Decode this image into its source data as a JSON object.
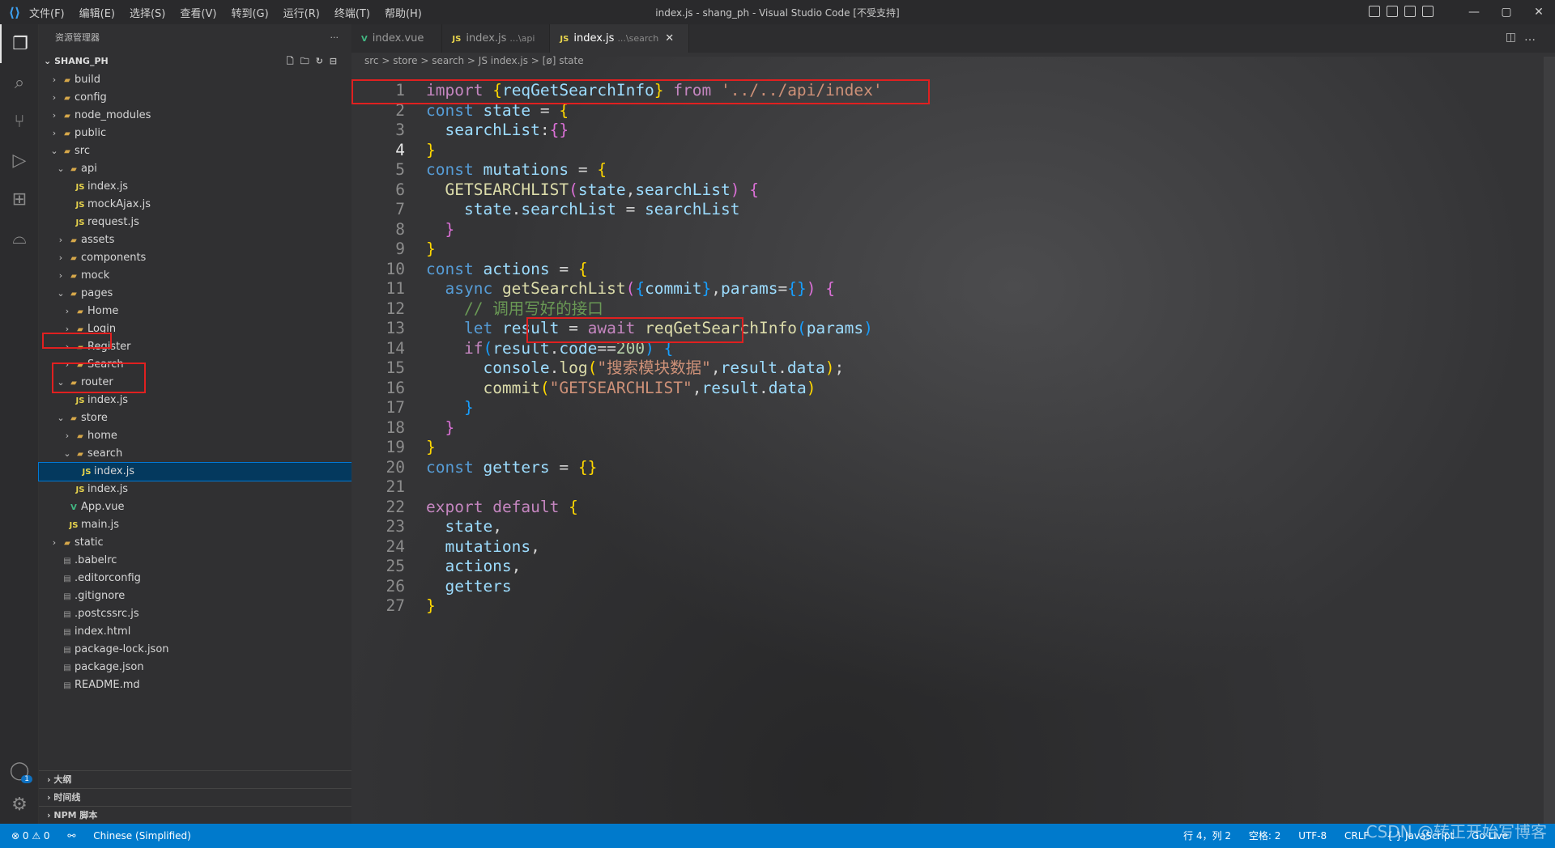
{
  "titlebar": {
    "menus": [
      "文件(F)",
      "编辑(E)",
      "选择(S)",
      "查看(V)",
      "转到(G)",
      "运行(R)",
      "终端(T)",
      "帮助(H)"
    ],
    "title": "index.js - shang_ph - Visual Studio Code [不受支持]",
    "controls": [
      "—",
      "▢",
      "✕"
    ]
  },
  "sidebar": {
    "header": "资源管理器",
    "more": "···",
    "project": "SHANG_PH",
    "tree": [
      {
        "label": "build",
        "depth": 1,
        "type": "folder",
        "open": false
      },
      {
        "label": "config",
        "depth": 1,
        "type": "folder",
        "open": false
      },
      {
        "label": "node_modules",
        "depth": 1,
        "type": "folder",
        "open": false
      },
      {
        "label": "public",
        "depth": 1,
        "type": "folder",
        "open": false
      },
      {
        "label": "src",
        "depth": 1,
        "type": "folder",
        "open": true
      },
      {
        "label": "api",
        "depth": 2,
        "type": "folder",
        "open": true
      },
      {
        "label": "index.js",
        "depth": 3,
        "type": "js"
      },
      {
        "label": "mockAjax.js",
        "depth": 3,
        "type": "js"
      },
      {
        "label": "request.js",
        "depth": 3,
        "type": "js"
      },
      {
        "label": "assets",
        "depth": 2,
        "type": "folder",
        "open": false
      },
      {
        "label": "components",
        "depth": 2,
        "type": "folder",
        "open": false
      },
      {
        "label": "mock",
        "depth": 2,
        "type": "folder",
        "open": false
      },
      {
        "label": "pages",
        "depth": 2,
        "type": "folder",
        "open": true
      },
      {
        "label": "Home",
        "depth": 3,
        "type": "folder",
        "open": false
      },
      {
        "label": "Login",
        "depth": 3,
        "type": "folder",
        "open": false
      },
      {
        "label": "Register",
        "depth": 3,
        "type": "folder",
        "open": false
      },
      {
        "label": "Search",
        "depth": 3,
        "type": "folder",
        "open": false
      },
      {
        "label": "router",
        "depth": 2,
        "type": "folder",
        "open": true
      },
      {
        "label": "index.js",
        "depth": 3,
        "type": "js"
      },
      {
        "label": "store",
        "depth": 2,
        "type": "folder",
        "open": true
      },
      {
        "label": "home",
        "depth": 3,
        "type": "folder",
        "open": false
      },
      {
        "label": "search",
        "depth": 3,
        "type": "folder",
        "open": true
      },
      {
        "label": "index.js",
        "depth": 4,
        "type": "js",
        "selected": true
      },
      {
        "label": "index.js",
        "depth": 3,
        "type": "js"
      },
      {
        "label": "App.vue",
        "depth": 2,
        "type": "vue"
      },
      {
        "label": "main.js",
        "depth": 2,
        "type": "js"
      },
      {
        "label": "static",
        "depth": 1,
        "type": "folder",
        "open": false
      },
      {
        "label": ".babelrc",
        "depth": 1,
        "type": "file"
      },
      {
        "label": ".editorconfig",
        "depth": 1,
        "type": "file"
      },
      {
        "label": ".gitignore",
        "depth": 1,
        "type": "file"
      },
      {
        "label": ".postcssrc.js",
        "depth": 1,
        "type": "file"
      },
      {
        "label": "index.html",
        "depth": 1,
        "type": "file"
      },
      {
        "label": "package-lock.json",
        "depth": 1,
        "type": "file"
      },
      {
        "label": "package.json",
        "depth": 1,
        "type": "file"
      },
      {
        "label": "README.md",
        "depth": 1,
        "type": "file"
      }
    ],
    "bottom_sections": [
      "大纲",
      "时间线",
      "NPM 脚本"
    ]
  },
  "activity": {
    "account_badge": "1"
  },
  "tabs": [
    {
      "icon": "V",
      "label": "index.vue",
      "hint": "",
      "active": false
    },
    {
      "icon": "JS",
      "label": "index.js",
      "hint": "...\\api",
      "active": false
    },
    {
      "icon": "JS",
      "label": "index.js",
      "hint": "...\\search",
      "active": true
    }
  ],
  "breadcrumb": "src > store > search > JS index.js > [ø] state",
  "code": {
    "current_line": 4,
    "lines": [
      [
        [
          "kw2",
          "import"
        ],
        [
          "plain",
          " "
        ],
        [
          "br1",
          "{"
        ],
        [
          "var",
          "reqGetSearchInfo"
        ],
        [
          "br1",
          "}"
        ],
        [
          "plain",
          " "
        ],
        [
          "kw2",
          "from"
        ],
        [
          "plain",
          " "
        ],
        [
          "str",
          "'../../api/index'"
        ]
      ],
      [
        [
          "kw",
          "const"
        ],
        [
          "plain",
          " "
        ],
        [
          "var",
          "state"
        ],
        [
          "plain",
          " = "
        ],
        [
          "br1",
          "{"
        ]
      ],
      [
        [
          "plain",
          "  "
        ],
        [
          "var",
          "searchList"
        ],
        [
          "plain",
          ":"
        ],
        [
          "br2",
          "{}"
        ]
      ],
      [
        [
          "br1",
          "}"
        ]
      ],
      [
        [
          "kw",
          "const"
        ],
        [
          "plain",
          " "
        ],
        [
          "var",
          "mutations"
        ],
        [
          "plain",
          " = "
        ],
        [
          "br1",
          "{"
        ]
      ],
      [
        [
          "plain",
          "  "
        ],
        [
          "fn",
          "GETSEARCHLIST"
        ],
        [
          "br2",
          "("
        ],
        [
          "var",
          "state"
        ],
        [
          "plain",
          ","
        ],
        [
          "var",
          "searchList"
        ],
        [
          "br2",
          ")"
        ],
        [
          "plain",
          " "
        ],
        [
          "br2",
          "{"
        ]
      ],
      [
        [
          "plain",
          "    "
        ],
        [
          "var",
          "state"
        ],
        [
          "plain",
          "."
        ],
        [
          "var",
          "searchList"
        ],
        [
          "plain",
          " = "
        ],
        [
          "var",
          "searchList"
        ]
      ],
      [
        [
          "plain",
          "  "
        ],
        [
          "br2",
          "}"
        ]
      ],
      [
        [
          "br1",
          "}"
        ]
      ],
      [
        [
          "kw",
          "const"
        ],
        [
          "plain",
          " "
        ],
        [
          "var",
          "actions"
        ],
        [
          "plain",
          " = "
        ],
        [
          "br1",
          "{"
        ]
      ],
      [
        [
          "plain",
          "  "
        ],
        [
          "kw",
          "async"
        ],
        [
          "plain",
          " "
        ],
        [
          "fn",
          "getSearchList"
        ],
        [
          "br2",
          "("
        ],
        [
          "br3",
          "{"
        ],
        [
          "var",
          "commit"
        ],
        [
          "br3",
          "}"
        ],
        [
          "plain",
          ","
        ],
        [
          "var",
          "params"
        ],
        [
          "plain",
          "="
        ],
        [
          "br3",
          "{}"
        ],
        [
          "br2",
          ")"
        ],
        [
          "plain",
          " "
        ],
        [
          "br2",
          "{"
        ]
      ],
      [
        [
          "plain",
          "    "
        ],
        [
          "cmt",
          "// 调用写好的接口"
        ]
      ],
      [
        [
          "plain",
          "    "
        ],
        [
          "kw",
          "let"
        ],
        [
          "plain",
          " "
        ],
        [
          "var",
          "result"
        ],
        [
          "plain",
          " = "
        ],
        [
          "kw2",
          "await"
        ],
        [
          "plain",
          " "
        ],
        [
          "fn",
          "reqGetSearchInfo"
        ],
        [
          "br3",
          "("
        ],
        [
          "var",
          "params"
        ],
        [
          "br3",
          ")"
        ]
      ],
      [
        [
          "plain",
          "    "
        ],
        [
          "kw2",
          "if"
        ],
        [
          "br3",
          "("
        ],
        [
          "var",
          "result"
        ],
        [
          "plain",
          "."
        ],
        [
          "var",
          "code"
        ],
        [
          "plain",
          "=="
        ],
        [
          "num",
          "200"
        ],
        [
          "br3",
          ")"
        ],
        [
          "plain",
          " "
        ],
        [
          "br3",
          "{"
        ]
      ],
      [
        [
          "plain",
          "      "
        ],
        [
          "var",
          "console"
        ],
        [
          "plain",
          "."
        ],
        [
          "fn",
          "log"
        ],
        [
          "br1",
          "("
        ],
        [
          "str",
          "\"搜索模块数据\""
        ],
        [
          "plain",
          ","
        ],
        [
          "var",
          "result"
        ],
        [
          "plain",
          "."
        ],
        [
          "var",
          "data"
        ],
        [
          "br1",
          ")"
        ],
        [
          "plain",
          ";"
        ]
      ],
      [
        [
          "plain",
          "      "
        ],
        [
          "fn",
          "commit"
        ],
        [
          "br1",
          "("
        ],
        [
          "str",
          "\"GETSEARCHLIST\""
        ],
        [
          "plain",
          ","
        ],
        [
          "var",
          "result"
        ],
        [
          "plain",
          "."
        ],
        [
          "var",
          "data"
        ],
        [
          "br1",
          ")"
        ]
      ],
      [
        [
          "plain",
          "    "
        ],
        [
          "br3",
          "}"
        ]
      ],
      [
        [
          "plain",
          "  "
        ],
        [
          "br2",
          "}"
        ]
      ],
      [
        [
          "br1",
          "}"
        ]
      ],
      [
        [
          "kw",
          "const"
        ],
        [
          "plain",
          " "
        ],
        [
          "var",
          "getters"
        ],
        [
          "plain",
          " = "
        ],
        [
          "br1",
          "{}"
        ]
      ],
      [],
      [
        [
          "kw2",
          "export"
        ],
        [
          "plain",
          " "
        ],
        [
          "kw2",
          "default"
        ],
        [
          "plain",
          " "
        ],
        [
          "br1",
          "{"
        ]
      ],
      [
        [
          "plain",
          "  "
        ],
        [
          "var",
          "state"
        ],
        [
          "plain",
          ","
        ]
      ],
      [
        [
          "plain",
          "  "
        ],
        [
          "var",
          "mutations"
        ],
        [
          "plain",
          ","
        ]
      ],
      [
        [
          "plain",
          "  "
        ],
        [
          "var",
          "actions"
        ],
        [
          "plain",
          ","
        ]
      ],
      [
        [
          "plain",
          "  "
        ],
        [
          "var",
          "getters"
        ]
      ],
      [
        [
          "br1",
          "}"
        ]
      ]
    ]
  },
  "statusbar": {
    "problems": "⊗ 0 ⚠ 0",
    "language_pack": "Chinese (Simplified)",
    "position": "行 4，列 2",
    "spaces": "空格: 2",
    "encoding": "UTF-8",
    "eol": "CRLF",
    "language": "{ } JavaScript",
    "golive": "Go Live"
  },
  "watermark": "CSDN @转正开始写博客"
}
